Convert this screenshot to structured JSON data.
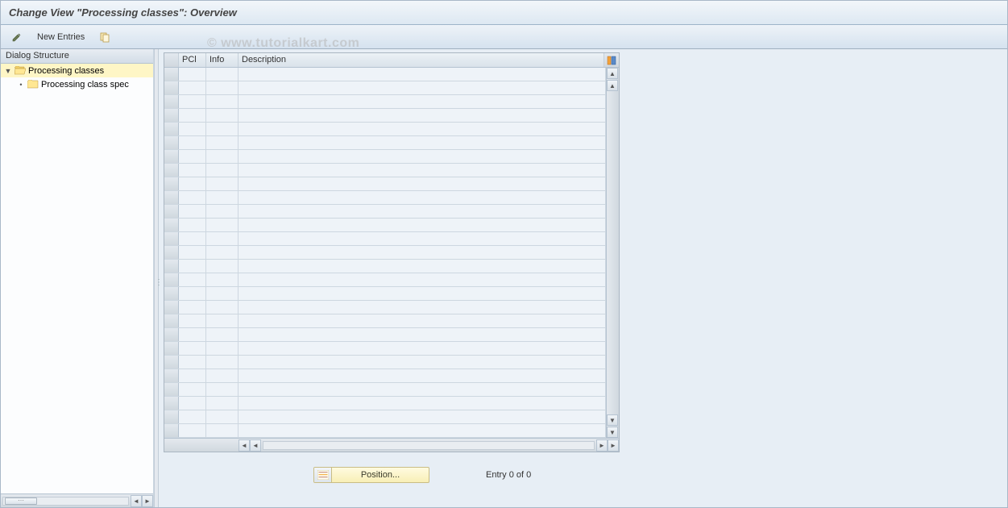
{
  "title": "Change View \"Processing classes\": Overview",
  "toolbar": {
    "new_entries_label": "New Entries"
  },
  "watermark": "© www.tutorialkart.com",
  "sidebar": {
    "header": "Dialog Structure",
    "items": [
      {
        "label": "Processing classes",
        "selected": true,
        "open": true
      },
      {
        "label": "Processing class spec",
        "selected": false,
        "open": false
      }
    ]
  },
  "table": {
    "columns": {
      "pcl": "PCl",
      "info": "Info",
      "desc": "Description"
    },
    "row_count": 27
  },
  "footer": {
    "position_label": "Position...",
    "entry_text": "Entry 0 of 0"
  }
}
